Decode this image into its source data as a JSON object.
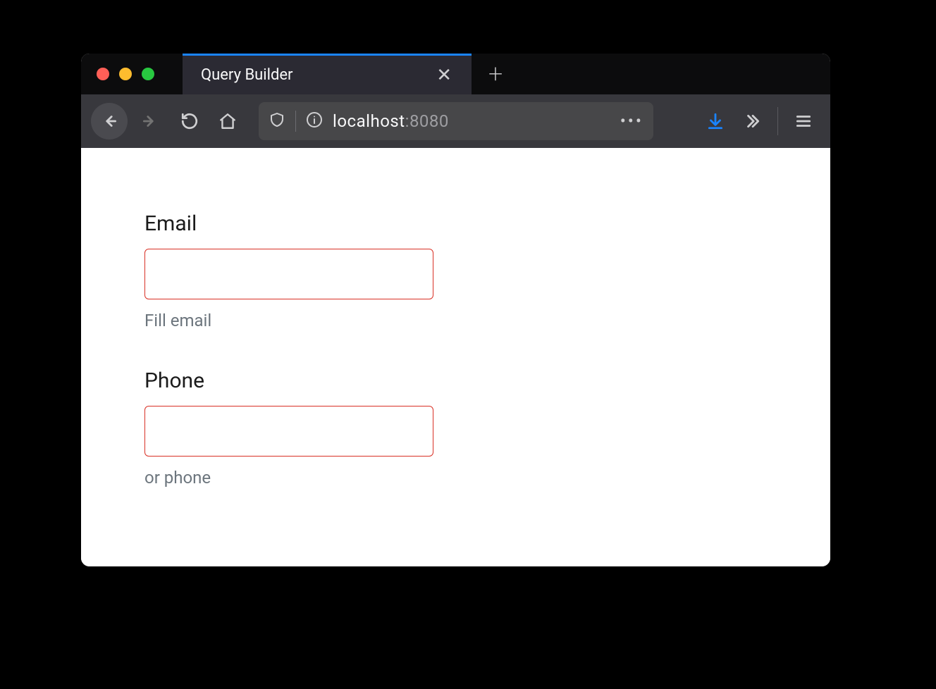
{
  "browser": {
    "tab_title": "Query Builder",
    "url_host": "localhost",
    "url_port": ":8080"
  },
  "form": {
    "email": {
      "label": "Email",
      "value": "",
      "hint": "Fill email"
    },
    "phone": {
      "label": "Phone",
      "value": "",
      "hint": "or phone"
    }
  }
}
